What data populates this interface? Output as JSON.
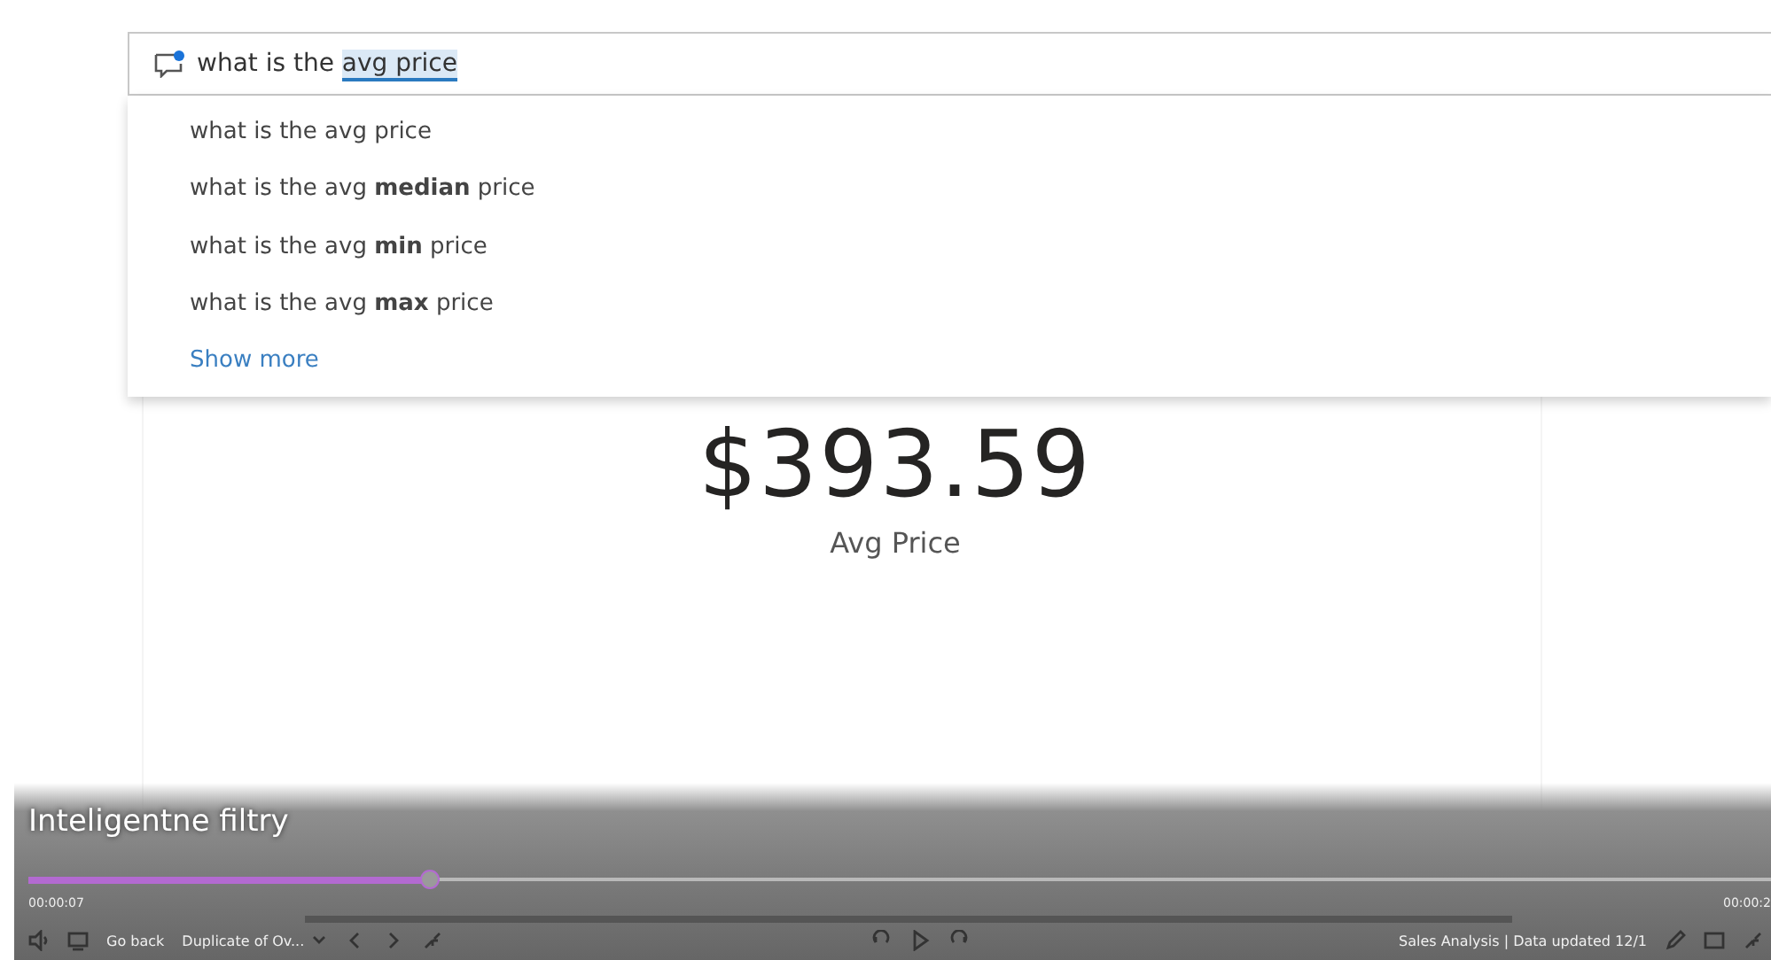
{
  "qna": {
    "query": [
      {
        "text": "what is the ",
        "highlighted": false
      },
      {
        "text": "avg price",
        "highlighted": true
      }
    ],
    "suggestions": [
      "what is the avg price",
      "what is the avg **median** price",
      "what is the avg **min** price",
      "what is the avg **max** price"
    ],
    "show_more": "Show more"
  },
  "card": {
    "value": "$393.59",
    "label": "Avg Price"
  },
  "player": {
    "title": "Inteligentne filtry",
    "progress": {
      "level": 0.23
    },
    "elapsed": "00:00:07",
    "total": "00:00:2",
    "back": "Go back",
    "page_menu": "Duplicate of Ov...",
    "report_info": "Sales Analysis | Data updated 12/1"
  }
}
